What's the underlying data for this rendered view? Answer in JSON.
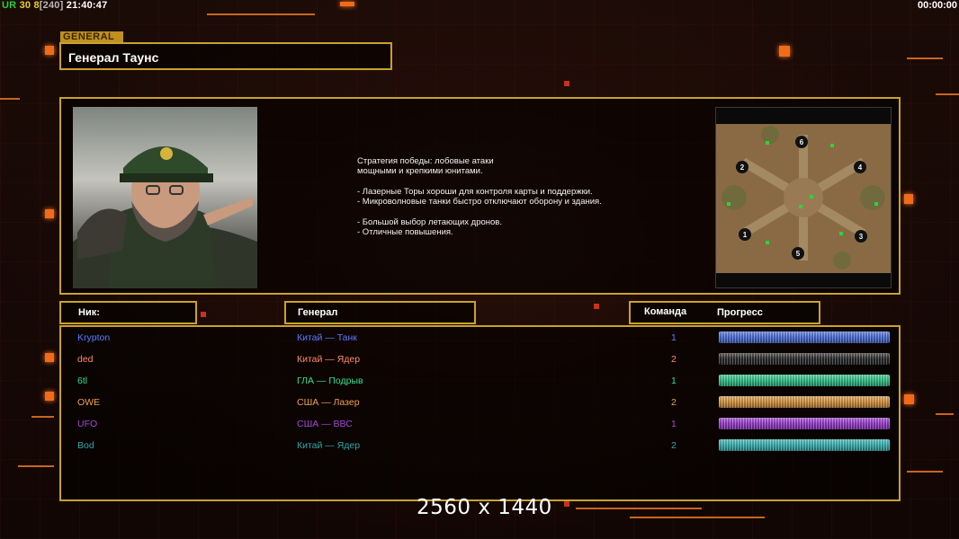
{
  "hud": {
    "ur": "UR",
    "n1": "30",
    "n2": "8",
    "bracket": "[240]",
    "clock": "21:40:47",
    "timer": "00:00:00"
  },
  "general_tag": "GENERAL",
  "general_name": "Генерал Таунс",
  "description": "Стратегия победы: лобовые атаки\nмощными и крепкими юнитами.\n\n- Лазерные Торы хороши для контроля карты и поддержки.\n- Микроволновые танки быстро отключают оборону и здания.\n\n- Большой выбор летающих дронов.\n- Отличные повышения.",
  "minimap": {
    "spots": [
      "1",
      "2",
      "3",
      "4",
      "5",
      "6"
    ]
  },
  "headers": {
    "nick": "Ник:",
    "general": "Генерал",
    "team": "Команда",
    "progress": "Прогресс"
  },
  "players": [
    {
      "nick": "Krypton",
      "general": "Китай — Танк",
      "team": "1",
      "color": "#5b7cff",
      "bar": "#4a6cd9",
      "progress": 1.0
    },
    {
      "nick": "ded",
      "general": "Китай — Ядер",
      "team": "2",
      "color": "#ff8a6a",
      "bar": "#2a2a2a",
      "progress": 1.0
    },
    {
      "nick": "6tl",
      "general": "ГЛА — Подрыв",
      "team": "1",
      "color": "#3bdc8e",
      "bar": "#2fc487",
      "progress": 1.0
    },
    {
      "nick": "OWE",
      "general": "США — Лазер",
      "team": "2",
      "color": "#f0a04a",
      "bar": "#d9953e",
      "progress": 1.0
    },
    {
      "nick": "UFO",
      "general": "США — ВВС",
      "team": "1",
      "color": "#a24ad6",
      "bar": "#9a3ad0",
      "progress": 1.0
    },
    {
      "nick": "Bod",
      "general": "Китай — Ядер",
      "team": "2",
      "color": "#2fa6a6",
      "bar": "#36b2b2",
      "progress": 1.0
    }
  ],
  "watermark": "2560 x 1440",
  "colors": {
    "accent": "#c9a22a",
    "orange": "#f26a1b"
  }
}
